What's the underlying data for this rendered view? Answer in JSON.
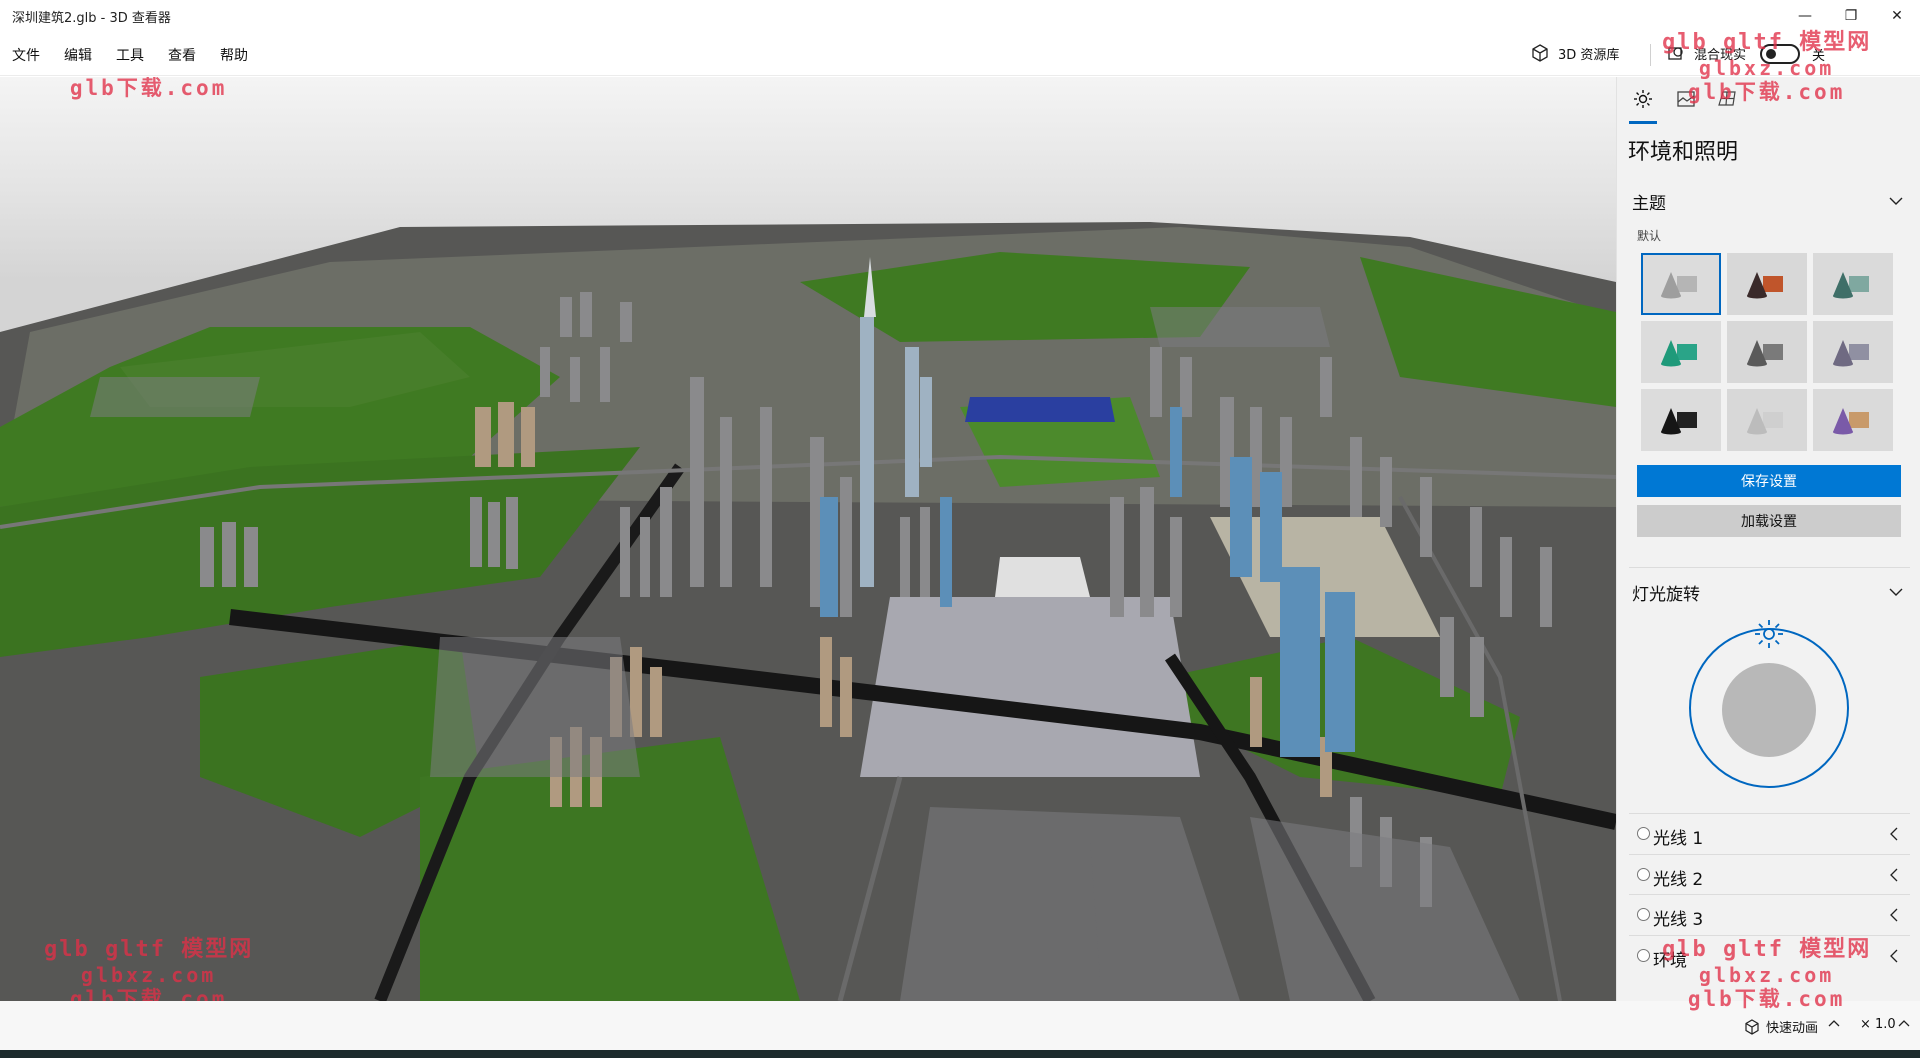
{
  "window": {
    "title": "深圳建筑2.glb - 3D 查看器",
    "minimize_glyph": "—",
    "maximize_glyph": "❐",
    "close_glyph": "✕"
  },
  "menu": {
    "file": "文件",
    "edit": "编辑",
    "tools": "工具",
    "view": "查看",
    "help": "帮助"
  },
  "commands": {
    "library": "3D 资源库",
    "mixed_reality": "混合现实",
    "mixed_reality_state": "关"
  },
  "panel": {
    "tabs": [
      {
        "name": "environment",
        "icon": "sun-icon",
        "active": true
      },
      {
        "name": "stats",
        "icon": "image-stats-icon",
        "active": false
      },
      {
        "name": "grid",
        "icon": "grid-icon",
        "active": false
      }
    ],
    "title": "环境和照明",
    "theme_section": "主题",
    "theme_default_label": "默认",
    "themes": [
      {
        "bg": "#dcdcdc",
        "shape": "#9e9e9e",
        "box": "#b5b5b5",
        "selected": true
      },
      {
        "bg": "#d8d8d8",
        "shape": "#3a2a2a",
        "box": "#c0552b",
        "selected": false
      },
      {
        "bg": "#dadada",
        "shape": "#3f6f68",
        "box": "#7fa8a0",
        "selected": false
      },
      {
        "bg": "#dcdcdc",
        "shape": "#1f9a7a",
        "box": "#2aa488",
        "selected": false
      },
      {
        "bg": "#d8d8d8",
        "shape": "#5a5a5a",
        "box": "#7a7a7a",
        "selected": false
      },
      {
        "bg": "#dadada",
        "shape": "#6f6a82",
        "box": "#9090a2",
        "selected": false
      },
      {
        "bg": "#dcdcdc",
        "shape": "#161616",
        "box": "#222222",
        "selected": false
      },
      {
        "bg": "#d8d8d8",
        "shape": "#bcbcbc",
        "box": "#cfcfcf",
        "selected": false
      },
      {
        "bg": "#dadada",
        "shape": "#7a5aa8",
        "box": "#c89a6a",
        "selected": false
      }
    ],
    "save_button": "保存设置",
    "load_button": "加载设置",
    "light_rotation_section": "灯光旋转",
    "lights": [
      "光线 1",
      "光线 2",
      "光线 3",
      "环境"
    ]
  },
  "status": {
    "animation_label": "快速动画",
    "speed": "× 1.0"
  },
  "watermark": {
    "line1": "glb gltf 模型网",
    "line2": "glbxz.com",
    "line3": "glb下载.com"
  },
  "colors": {
    "accent": "#0078d4",
    "accent_dark": "#0067c0",
    "watermark": "#e03048",
    "ground": "#5a5a58",
    "grass": "#3f7a22",
    "road": "#1a1a1a"
  }
}
